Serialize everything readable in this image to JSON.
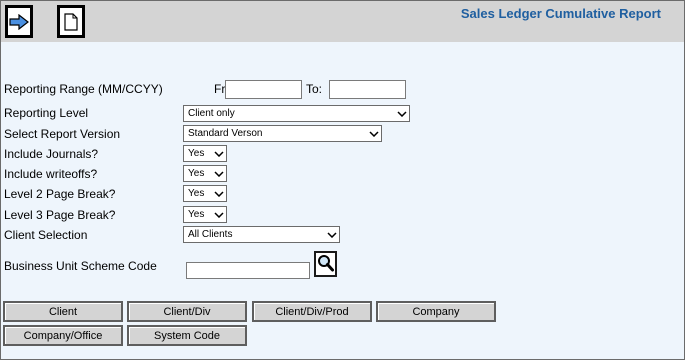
{
  "header": {
    "title": "Sales Ledger Cumulative Report",
    "toolbar": [
      {
        "name": "run-report-button",
        "icon": "arrow-right-icon"
      },
      {
        "name": "new-document-button",
        "icon": "document-icon"
      }
    ]
  },
  "form": {
    "range_label": "Reporting Range (MM/CCYY)",
    "from_label": "From:",
    "to_label": "To:",
    "from_value": "",
    "to_value": "",
    "level_label": "Reporting Level",
    "level_value": "Client only",
    "version_label": "Select Report Version",
    "version_value": "Standard Verson",
    "journals_label": "Include Journals?",
    "journals_value": "Yes",
    "writeoffs_label": "Include writeoffs?",
    "writeoffs_value": "Yes",
    "level2_label": "Level 2 Page Break?",
    "level2_value": "Yes",
    "level3_label": "Level 3 Page Break?",
    "level3_value": "Yes",
    "client_sel_label": "Client Selection",
    "client_sel_value": "All Clients",
    "bu_label": "Business Unit Scheme Code",
    "bu_value": ""
  },
  "buttons": {
    "client": "Client",
    "client_div": "Client/Div",
    "client_div_prod": "Client/Div/Prod",
    "company": "Company",
    "company_office": "Company/Office",
    "system_code": "System Code"
  },
  "colors": {
    "title": "#1f5fa0",
    "toolbar_bg": "#d4d4d4",
    "page_bg": "#eef5fc",
    "button_bg": "#d4d4d4"
  }
}
